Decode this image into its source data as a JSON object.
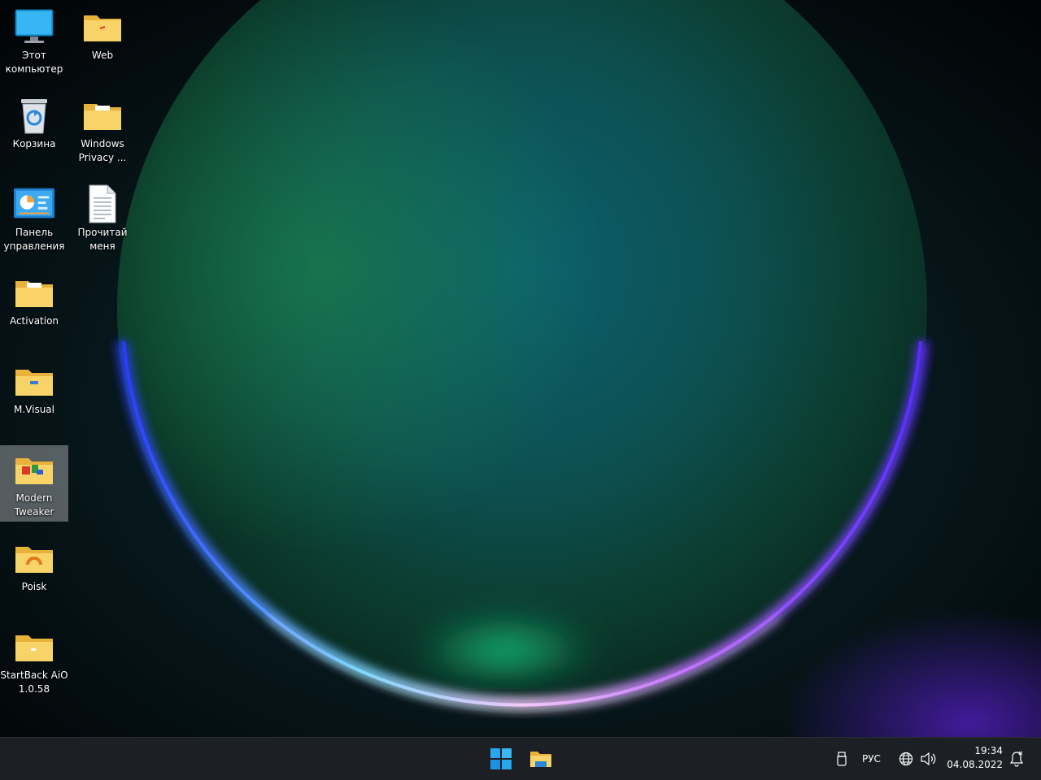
{
  "desktop": {
    "icons": [
      {
        "label": "Этот\nкомпьютер",
        "icon": "this-pc-icon"
      },
      {
        "label": "Web",
        "icon": "folder-icon"
      },
      {
        "label": "Корзина",
        "icon": "recycle-bin-icon"
      },
      {
        "label": "Windows\nPrivacy ...",
        "icon": "folder-icon"
      },
      {
        "label": "Панель\nуправления",
        "icon": "control-panel-icon"
      },
      {
        "label": "Прочитай\nменя",
        "icon": "text-document-icon"
      },
      {
        "label": "Activation",
        "icon": "folder-icon"
      },
      {
        "label": "M.Visual",
        "icon": "folder-icon"
      },
      {
        "label": "Modern\nTweaker",
        "icon": "folder-icon",
        "selected": true
      },
      {
        "label": "Poisk",
        "icon": "folder-icon"
      },
      {
        "label": "StartBack AiO\n1.0.58",
        "icon": "folder-icon"
      }
    ]
  },
  "taskbar": {
    "start_icon": "windows-start-icon",
    "pinned": [
      {
        "icon": "file-explorer-icon"
      }
    ],
    "tray": {
      "language": "РУС",
      "clock_time": "19:34",
      "clock_date": "04.08.2022"
    }
  },
  "colors": {
    "taskbar_bg": "#1c1f24",
    "folder_yellow": "#f5c84a",
    "start_blue": "#2aa6f0"
  }
}
